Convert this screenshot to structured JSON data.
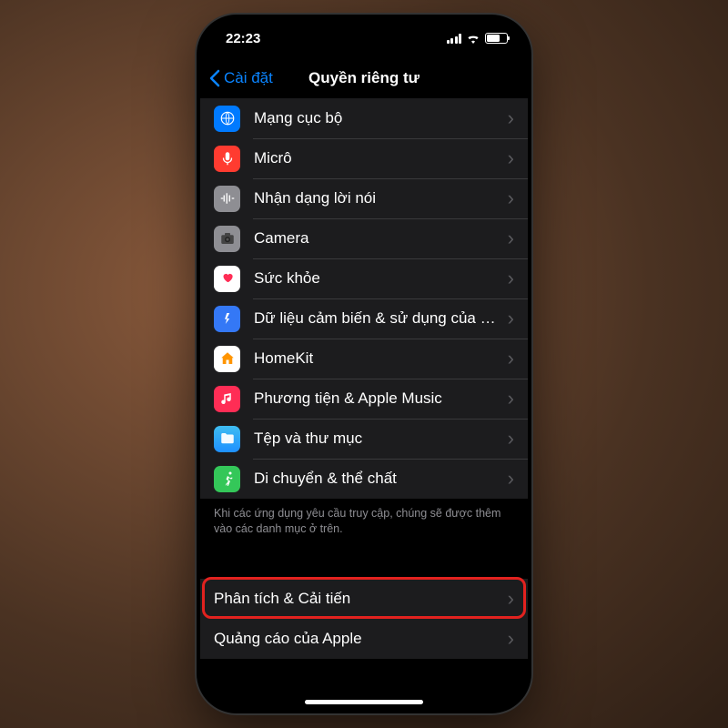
{
  "status": {
    "time": "22:23"
  },
  "nav": {
    "back_label": "Cài đặt",
    "title": "Quyền riêng tư"
  },
  "group1": {
    "items": [
      {
        "icon": "globe-icon",
        "bg": "bg-blue",
        "label": "Mạng cục bộ"
      },
      {
        "icon": "mic-icon",
        "bg": "bg-red",
        "label": "Micrô"
      },
      {
        "icon": "wave-icon",
        "bg": "bg-gray",
        "label": "Nhận dạng lời nói"
      },
      {
        "icon": "camera-icon",
        "bg": "bg-gray",
        "label": "Camera"
      },
      {
        "icon": "heart-icon",
        "bg": "bg-white",
        "label": "Sức khỏe"
      },
      {
        "icon": "research-icon",
        "bg": "bg-blue2",
        "label": "Dữ liệu cảm biến & sử dụng của N..."
      },
      {
        "icon": "home-icon",
        "bg": "bg-white",
        "label": "HomeKit"
      },
      {
        "icon": "music-icon",
        "bg": "bg-pink",
        "label": "Phương tiện & Apple Music"
      },
      {
        "icon": "folder-icon",
        "bg": "bg-cyan",
        "label": "Tệp và thư mục"
      },
      {
        "icon": "fitness-icon",
        "bg": "bg-green",
        "label": "Di chuyển & thể chất"
      }
    ],
    "footer": "Khi các ứng dụng yêu cầu truy cập, chúng sẽ được thêm vào các danh mục ở trên."
  },
  "group2": {
    "items": [
      {
        "label": "Phân tích & Cải tiến",
        "highlight": true
      },
      {
        "label": "Quảng cáo của Apple"
      }
    ]
  }
}
